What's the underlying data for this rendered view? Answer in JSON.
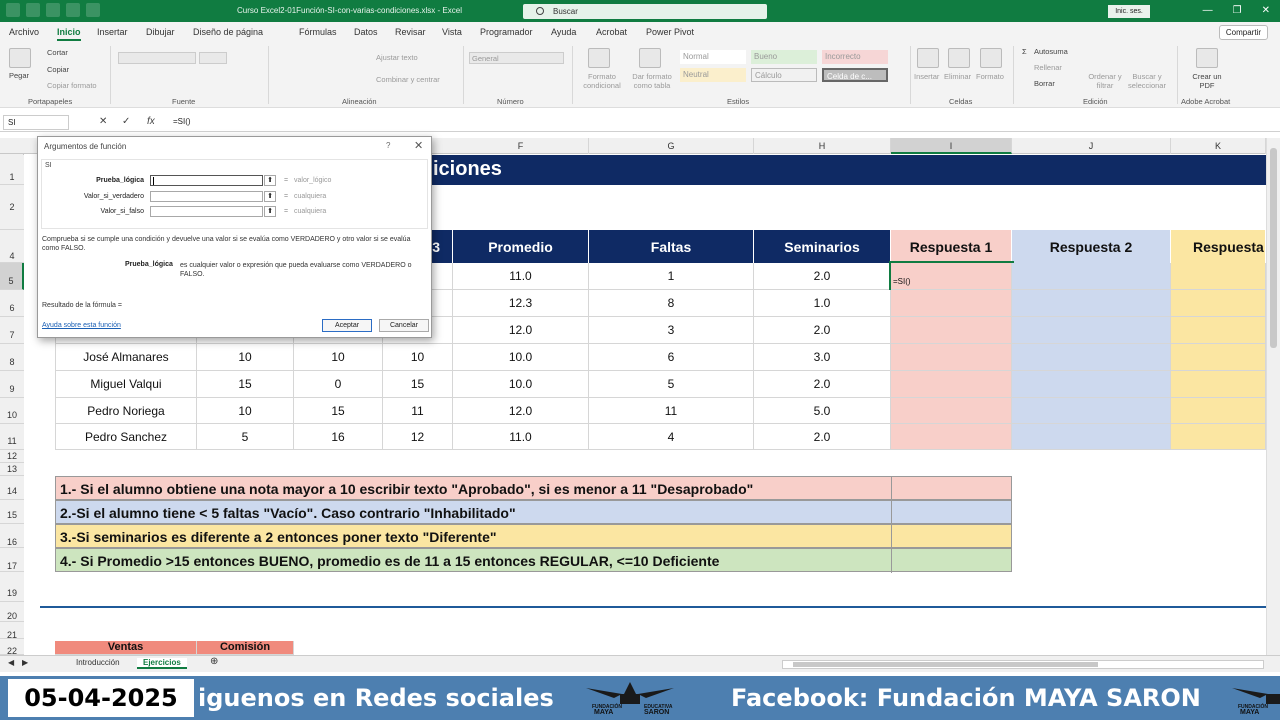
{
  "window": {
    "title": "Curso Excel2-01Función-SI-con-varias-condiciones.xlsx  -  Excel",
    "search_placeholder": "Buscar",
    "signin": "Inic. ses.",
    "brand_color": "#107c41"
  },
  "tabs": [
    "Archivo",
    "Inicio",
    "Insertar",
    "Dibujar",
    "Diseño de página",
    "Fórmulas",
    "Datos",
    "Revisar",
    "Vista",
    "Programador",
    "Ayuda",
    "Acrobat",
    "Power Pivot"
  ],
  "share_label": "Compartir",
  "ribbon": {
    "clipboard": {
      "paste": "Pegar",
      "cut": "Cortar",
      "copy": "Copiar",
      "format_painter": "Copiar formato",
      "label": "Portapapeles"
    },
    "font": {
      "label": "Fuente"
    },
    "alignment": {
      "wrap": "Ajustar texto",
      "merge": "Combinar y centrar",
      "label": "Alineación"
    },
    "number": {
      "format": "General",
      "label": "Número"
    },
    "styles": {
      "conditional": "Formato condicional",
      "as_table": "Dar formato como tabla",
      "normal": "Normal",
      "good": "Bueno",
      "bad": "Incorrecto",
      "neutral": "Neutral",
      "calc": "Cálculo",
      "check": "Celda de c...",
      "label": "Estilos"
    },
    "cells": {
      "insert": "Insertar",
      "delete": "Eliminar",
      "format": "Formato",
      "label": "Celdas"
    },
    "editing": {
      "autosum": "Autosuma",
      "fill": "Rellenar",
      "clear": "Borrar",
      "sort": "Ordenar y filtrar",
      "find": "Buscar y seleccionar",
      "label": "Edición"
    },
    "acrobat": {
      "create_pdf": "Crear un PDF",
      "label": "Adobe Acrobat"
    }
  },
  "formula_bar": {
    "name_box": "SI",
    "formula": "=SI()"
  },
  "columns": [
    "F",
    "G",
    "H",
    "I",
    "J",
    "K"
  ],
  "rows": [
    "1",
    "2",
    "3",
    "4",
    "5",
    "6",
    "7",
    "8",
    "9",
    "10",
    "11",
    "12",
    "13",
    "14",
    "15",
    "16",
    "17",
    "18",
    "19",
    "20",
    "21",
    "22"
  ],
  "sheet": {
    "title_fragment": "iciones",
    "headers": {
      "c3": "3",
      "promedio": "Promedio",
      "faltas": "Faltas",
      "seminarios": "Seminarios",
      "r1": "Respuesta 1",
      "r2": "Respuesta 2",
      "r3": "Respuesta 3"
    },
    "data_rows": [
      {
        "name": "",
        "n1": "",
        "n2": "",
        "n3": "",
        "prom": "11.0",
        "faltas": "1",
        "sem": "2.0",
        "r1": "=SI()"
      },
      {
        "name": "",
        "n1": "",
        "n2": "",
        "n3": "",
        "prom": "12.3",
        "faltas": "8",
        "sem": "1.0",
        "r1": ""
      },
      {
        "name": "",
        "n1": "",
        "n2": "",
        "n3": "10",
        "prom": "12.0",
        "faltas": "3",
        "sem": "2.0",
        "r1": ""
      },
      {
        "name": "José Almanares",
        "n1": "10",
        "n2": "10",
        "n3": "10",
        "prom": "10.0",
        "faltas": "6",
        "sem": "3.0",
        "r1": ""
      },
      {
        "name": "Miguel Valqui",
        "n1": "15",
        "n2": "0",
        "n3": "15",
        "prom": "10.0",
        "faltas": "5",
        "sem": "2.0",
        "r1": ""
      },
      {
        "name": "Pedro Noriega",
        "n1": "10",
        "n2": "15",
        "n3": "11",
        "prom": "12.0",
        "faltas": "11",
        "sem": "5.0",
        "r1": ""
      },
      {
        "name": "Pedro Sanchez",
        "n1": "5",
        "n2": "16",
        "n3": "12",
        "prom": "11.0",
        "faltas": "4",
        "sem": "2.0",
        "r1": ""
      }
    ],
    "rules": [
      "1.- Si el alumno obtiene una nota mayor a 10 escribir texto \"Aprobado\", si es menor a 11 \"Desaprobado\"",
      "2.-Si el alumno tiene < 5 faltas \"Vacío\". Caso contrario \"Inhabilitado\"",
      "3.-Si seminarios es diferente a 2 entonces poner texto \"Diferente\"",
      "4.- Si Promedio >15 entonces BUENO, promedio es de 11 a 15 entonces REGULAR,  <=10 Deficiente"
    ],
    "rule_colors": [
      "#f8cfc9",
      "#cdd9ee",
      "#fbe6a2",
      "#cde5bf"
    ],
    "ventas": "Ventas",
    "comision": "Comisión"
  },
  "dialog": {
    "title": "Argumentos de función",
    "help_q": "?",
    "close": "✕",
    "function": "SI",
    "args": [
      {
        "label": "Prueba_lógica",
        "value": "valor_lógico"
      },
      {
        "label": "Valor_si_verdadero",
        "value": "cualquiera"
      },
      {
        "label": "Valor_si_falso",
        "value": "cualquiera"
      }
    ],
    "eq": "=",
    "description": "Comprueba si se cumple una condición y devuelve una valor si se evalúa como VERDADERO y otro valor si se evalúa como FALSO.",
    "arg_help_label": "Prueba_lógica",
    "arg_help": "es cualquier valor o expresión que pueda evaluarse como VERDADERO o FALSO.",
    "result": "Resultado de la fórmula =",
    "help_link": "Ayuda sobre esta función",
    "ok": "Aceptar",
    "cancel": "Cancelar"
  },
  "sheet_tabs": [
    "Introducción",
    "Ejercicios"
  ],
  "overlay": {
    "date": "05-04-2025",
    "ticker_left": "iguenos en Redes sociales",
    "ticker_right": "Facebook: Fundación MAYA SARON",
    "logo_left": "FUNDACIÓN",
    "logo_mid": "MAYA",
    "logo_right": "EDUCATIVA",
    "logo_right2": "SARON",
    "bar_color": "#4d7fb0"
  }
}
